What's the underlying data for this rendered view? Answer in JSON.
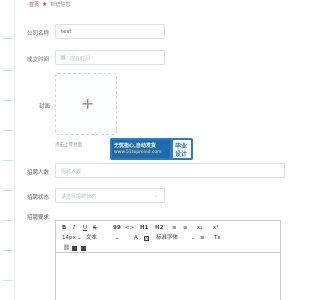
{
  "breadcrumb": {
    "home": "首页",
    "star": "★",
    "current": "新增信息"
  },
  "form": {
    "company_name": {
      "label": "公司名称",
      "value": "test"
    },
    "established": {
      "label": "成立时间",
      "icon": "calendar-icon",
      "placeholder": "成立时间"
    },
    "cover": {
      "label": "封面",
      "plus": "+",
      "tip": "点击上传封面"
    },
    "recruit_count": {
      "label": "招聘人数",
      "placeholder": "招聘人数"
    },
    "recruit_status": {
      "label": "招聘状态",
      "placeholder": "请选择招聘状态",
      "arrow": "⌄"
    },
    "requirements": {
      "label": "招聘要求"
    }
  },
  "watermark": {
    "line1": "无忧担心,自动发货",
    "line2": "www.51topmind.com",
    "right_top": "毕业",
    "right_bottom": "设计"
  },
  "editor_toolbar": {
    "row1": [
      "B",
      "I",
      "U",
      "S",
      "99",
      "<>",
      "H1",
      "H2",
      "≡",
      "≡",
      "x₂",
      "x²"
    ],
    "row2": [
      "14px",
      "⌄",
      "文本",
      "⌄",
      "A",
      "A",
      "标准字体",
      "⌄",
      "≡",
      "Tx"
    ]
  },
  "sidebar": {
    "color": "#d0e4f5"
  },
  "accent": "#e53935"
}
